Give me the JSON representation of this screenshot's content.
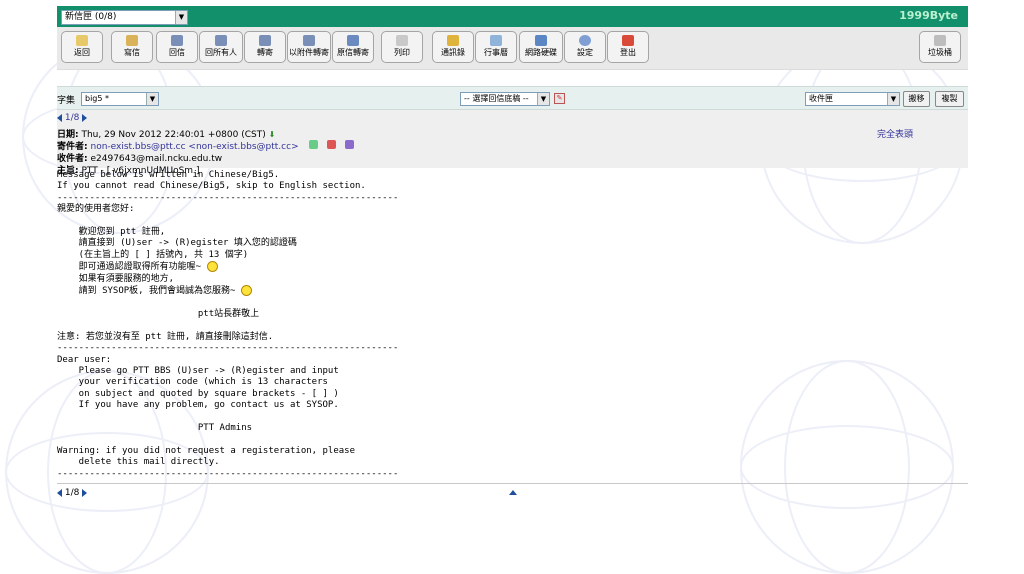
{
  "topbar": {
    "folder_select": "新信匣 (0/8)",
    "brand": "1999Byte"
  },
  "toolbar": {
    "back": "返回",
    "compose": "寫信",
    "reply": "回信",
    "reply_all": "回所有人",
    "forward": "轉寄",
    "forward_attach": "以附件轉寄",
    "forward_original": "原信轉寄",
    "print": "列印",
    "addressbook": "通訊錄",
    "calendar": "行事曆",
    "netdisk": "網路硬碟",
    "settings": "設定",
    "logout": "登出",
    "trash": "垃圾桶"
  },
  "options": {
    "charset_label": "字集",
    "charset_value": "big5 *",
    "reply_template": "-- 選擇回信底稿 --",
    "folder_target": "收件匣",
    "move": "搬移",
    "copy": "複製"
  },
  "nav": {
    "page": "1/8"
  },
  "header": {
    "date_label": "日期:",
    "date": "Thu, 29 Nov 2012 22:40:01 +0800 (CST)",
    "from_label": "寄件者:",
    "from": "non-exist.bbs@ptt.cc <non-exist.bbs@ptt.cc>",
    "to_label": "收件者:",
    "to": "e2497643@mail.ncku.edu.tw",
    "subject_label": "主旨:",
    "subject": "PTT - [ v6jxmnUdMUoSm ]",
    "full_header": "完全表頭"
  },
  "body": {
    "l1": "Message below is written in Chinese/Big5.",
    "l2": "If you cannot read Chinese/Big5, skip to English section.",
    "dashes": "---------------------------------------------------------------",
    "l3": "親愛的使用者您好:",
    "l4": "    歡迎您到 ptt 註冊,",
    "l5": "    請直接到 (U)ser -> (R)egister 填入您的認證碼",
    "l6": "    (在主旨上的 [ ] 括號內, 共 13 個字)",
    "l7": "    即可通過認證取得所有功能喔~ ",
    "l8": "    如果有須要服務的地方,",
    "l9": "    請到 SYSOP板, 我們會竭誠為您服務~ ",
    "l10": "                          ptt站長群敬上",
    "l11": "注意: 若您並沒有至 ptt 註冊, 請直接刪除這封信.",
    "l12": "Dear user:",
    "l13": "    Please go PTT BBS (U)ser -> (R)egister and input",
    "l14": "    your verification code (which is 13 characters",
    "l15": "    on subject and quoted by square brackets - [ ] )",
    "l16": "    If you have any problem, go contact us at SYSOP.",
    "l17": "                          PTT Admins",
    "l18": "Warning: if you did not request a registeration, please",
    "l19": "    delete this mail directly."
  },
  "footer": {
    "page": "1/8"
  }
}
